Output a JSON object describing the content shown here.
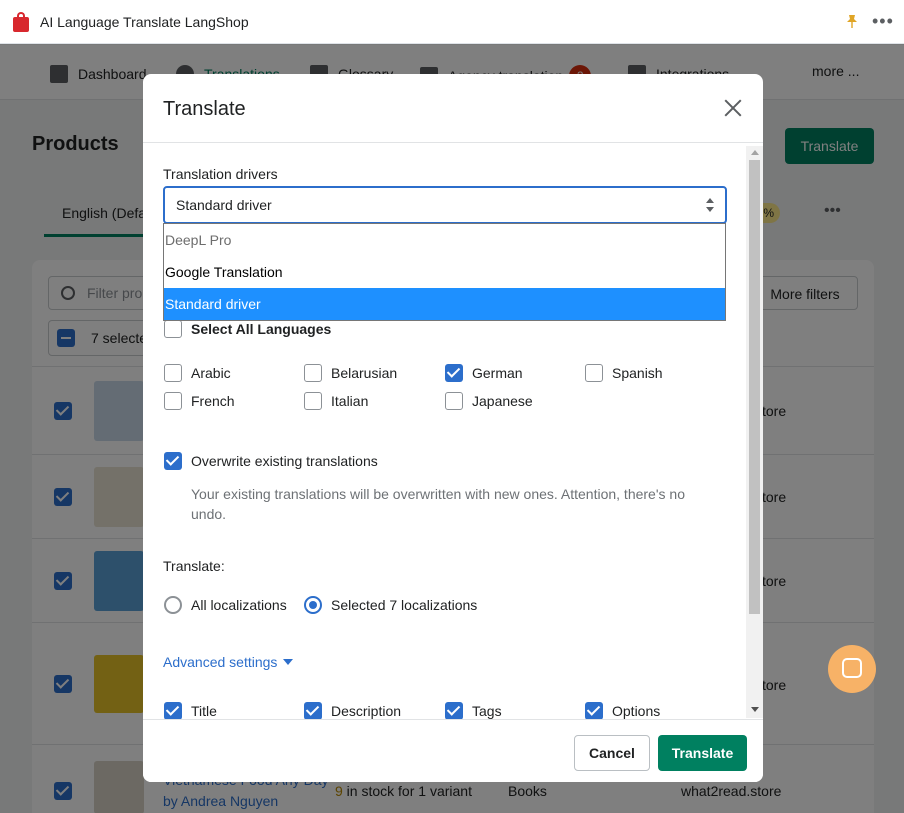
{
  "app": {
    "title": "AI Language Translate LangShop"
  },
  "nav": {
    "items": [
      {
        "label": "Dashboard"
      },
      {
        "label": "Translations"
      },
      {
        "label": "Glossary"
      },
      {
        "label": "Agency translation",
        "badge": "2"
      },
      {
        "label": "Integrations"
      }
    ],
    "more_label": "more ..."
  },
  "page": {
    "title": "Products",
    "translate_button": "Translate",
    "language_tab": "English (Defa",
    "pct": "%",
    "filter_placeholder": "Filter pro",
    "more_filters": "More filters",
    "selected_label": "7 selecte",
    "rows": [
      {
        "store": "tore"
      },
      {
        "store": "tore"
      },
      {
        "store": "tore"
      },
      {
        "store": "tore"
      }
    ],
    "last_row": {
      "title": "Vietnamese Food Any Day",
      "author": "by Andrea Nguyen",
      "stock_count": "9",
      "stock_text": " in stock for 1 variant",
      "type": "Books",
      "store": "what2read.store"
    }
  },
  "modal": {
    "title": "Translate",
    "drivers_label": "Translation drivers",
    "selected_driver": "Standard driver",
    "driver_options": [
      {
        "label": "DeepL Pro",
        "state": "disabled"
      },
      {
        "label": "Google Translation",
        "state": "normal"
      },
      {
        "label": "Standard driver",
        "state": "selected"
      }
    ],
    "select_all_label": "Select All Languages",
    "languages": [
      {
        "label": "Arabic",
        "checked": false
      },
      {
        "label": "Belarusian",
        "checked": false
      },
      {
        "label": "German",
        "checked": true
      },
      {
        "label": "Spanish",
        "checked": false
      },
      {
        "label": "French",
        "checked": false
      },
      {
        "label": "Italian",
        "checked": false
      },
      {
        "label": "Japanese",
        "checked": false
      }
    ],
    "overwrite_label": "Overwrite existing translations",
    "overwrite_checked": true,
    "overwrite_help": "Your existing translations will be overwritten with new ones. Attention, there's no undo.",
    "translate_label": "Translate:",
    "scope_options": [
      {
        "label": "All localizations",
        "selected": false
      },
      {
        "label": "Selected 7 localizations",
        "selected": true
      }
    ],
    "advanced_label": "Advanced settings",
    "fields": [
      {
        "label": "Title",
        "checked": true
      },
      {
        "label": "Description",
        "checked": true
      },
      {
        "label": "Tags",
        "checked": true
      },
      {
        "label": "Options",
        "checked": true
      }
    ],
    "cancel_label": "Cancel",
    "translate_button": "Translate"
  },
  "colors": {
    "primary": "#008060",
    "accent_blue": "#2c6ecb",
    "dropdown_highlight": "#1e90ff",
    "badge_red": "#d82c0d",
    "chat_orange": "#f7b267"
  }
}
